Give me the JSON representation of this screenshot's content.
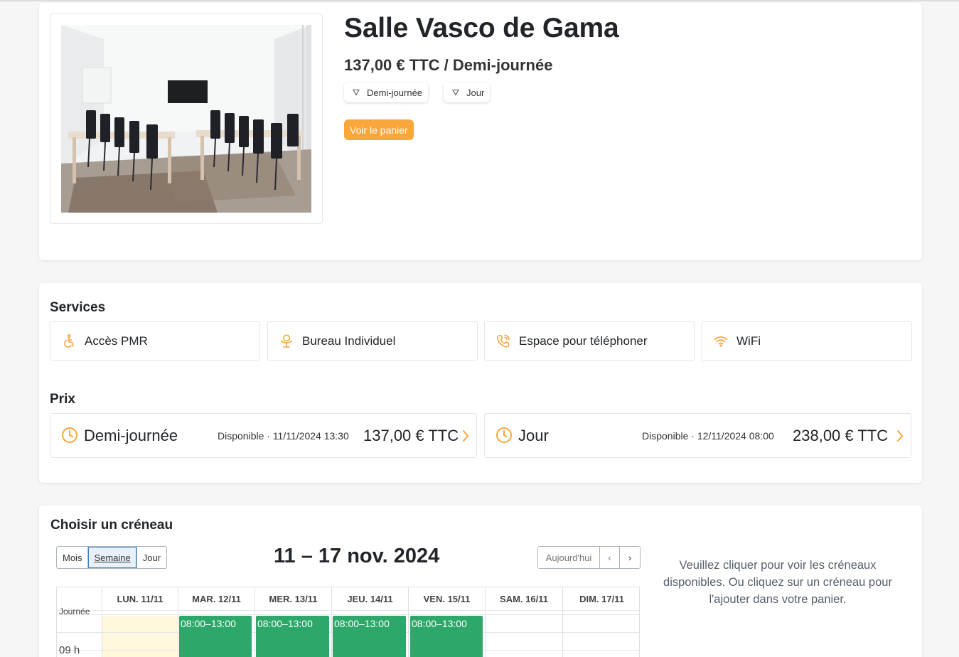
{
  "room": {
    "title": "Salle Vasco de Gama",
    "price": "137,00 € TTC / Demi-journée",
    "chips": [
      "Demi-journée",
      "Jour"
    ],
    "cart_button": "Voir le panier"
  },
  "services": {
    "title": "Services",
    "items": [
      {
        "label": "Accès PMR",
        "icon": "wheelchair-icon"
      },
      {
        "label": "Bureau Individuel",
        "icon": "desk-chair-icon"
      },
      {
        "label": "Espace pour téléphoner",
        "icon": "phone-ring-icon"
      },
      {
        "label": "WiFi",
        "icon": "wifi-icon"
      }
    ]
  },
  "prix": {
    "title": "Prix",
    "items": [
      {
        "label": "Demi-journée",
        "availability": "Disponible · 11/11/2024 13:30",
        "amount": "137,00 € TTC"
      },
      {
        "label": "Jour",
        "availability": "Disponible · 12/11/2024 08:00",
        "amount": "238,00 € TTC"
      }
    ]
  },
  "calendar": {
    "title": "Choisir un créneau",
    "views": [
      "Mois",
      "Semaine",
      "Jour"
    ],
    "active_view": "Semaine",
    "range": "11 – 17 nov. 2024",
    "today_button": "Aujourd'hui",
    "prev": "‹",
    "next": "›",
    "hint": "Veuillez cliquer pour voir les créneaux disponibles. Ou cliquez sur un créneau pour l'ajouter dans votre panier.",
    "days": [
      "LUN. 11/11",
      "MAR. 12/11",
      "MER. 13/11",
      "JEU. 14/11",
      "VEN. 15/11",
      "SAM. 16/11",
      "DIM. 17/11"
    ],
    "allday_label": "Journée",
    "hour_label": "09 h",
    "events": [
      {
        "day": "MAR. 12/11",
        "time": "08:00–13:00"
      },
      {
        "day": "MER. 13/11",
        "time": "08:00–13:00"
      },
      {
        "day": "JEU. 14/11",
        "time": "08:00–13:00"
      },
      {
        "day": "VEN. 15/11",
        "time": "08:00–13:00"
      }
    ]
  },
  "colors": {
    "accent": "#f9a63a",
    "event": "#2ea86a",
    "today": "#fff8dc"
  }
}
